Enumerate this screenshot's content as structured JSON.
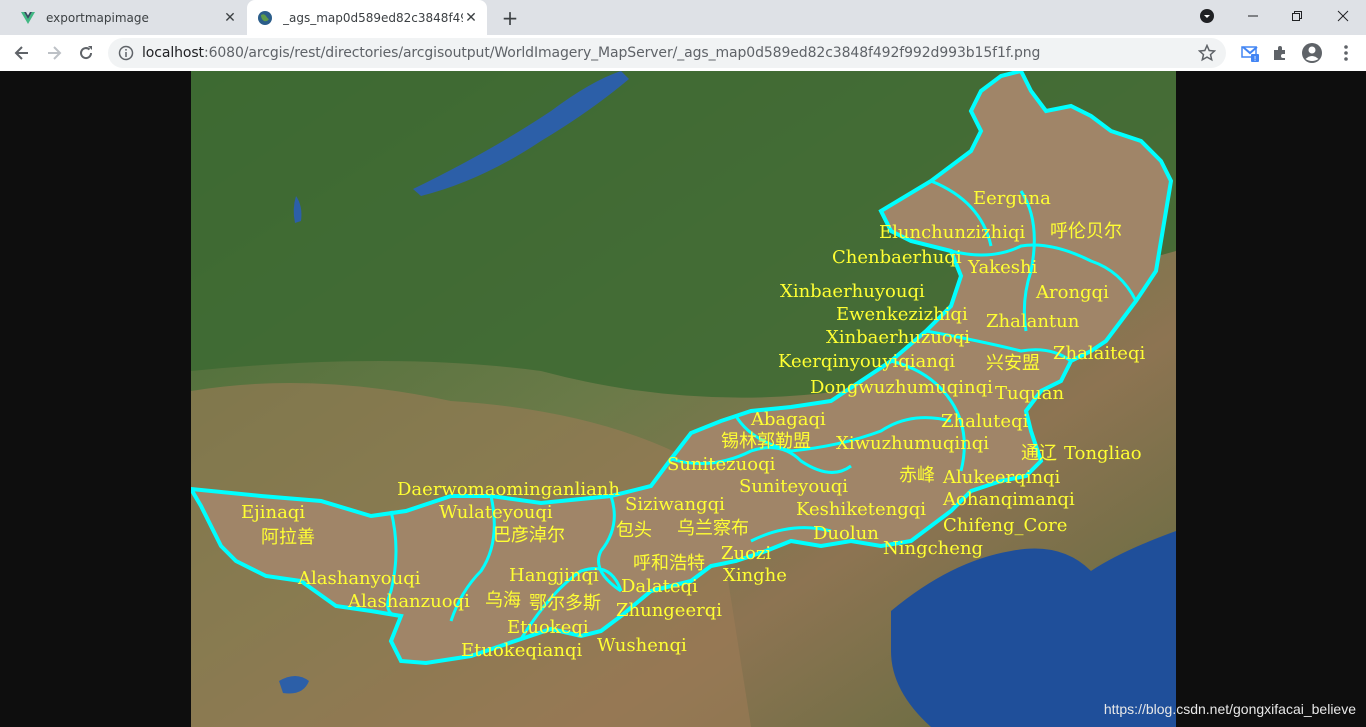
{
  "browser": {
    "tabs": [
      {
        "title": "exportmapimage",
        "active": false
      },
      {
        "title": "_ags_map0d589ed82c3848f49",
        "active": true
      }
    ],
    "new_tab_label": "+",
    "address": {
      "host": "localhost",
      "rest": ":6080/arcgis/rest/directories/arcgisoutput/WorldImagery_MapServer/_ags_map0d589ed82c3848f492f992d993b15f1f.png"
    },
    "icons": {
      "back": "back-arrow-icon",
      "forward": "forward-arrow-icon",
      "reload": "reload-icon",
      "info": "info-icon",
      "star": "bookmark-star-icon",
      "extensions": "puzzle-icon",
      "profile": "profile-icon"
    }
  },
  "map": {
    "accent_outline": "#00ffff",
    "fill": "#a08568",
    "label_color": "#ffff33",
    "labels": [
      "Eerguna",
      "Elunchunzizhiqi",
      "呼伦贝尔",
      "Chenbaerhuqi",
      "Yakeshi",
      "Xinbaerhuyouqi",
      "Arongqi",
      "Ewenkezizhiqi",
      "Zhalantun",
      "Xinbaerhuzuoqi",
      "Keerqinyouyiqianqi",
      "兴安盟",
      "Zhalaiteqi",
      "Dongwuzhumuqinqi",
      "Tuquan",
      "Abagaqi",
      "锡林郭勒盟",
      "Xiwuzhumuqinqi",
      "Zhaluteqi",
      "通辽",
      "Tongliao",
      "Sunitezuoqi",
      "赤峰",
      "Alukeerqinqi",
      "Suniteyouqi",
      "Aohanqimanqi",
      "Daerwomaominganlianh",
      "Siziwangqi",
      "Wulateyouqi",
      "Keshiketengqi",
      "Chifeng_Core",
      "Ejinaqi",
      "巴彦淖尔",
      "包头",
      "乌兰察布",
      "阿拉善",
      "Duolun",
      "Ningcheng",
      "Zuozi",
      "呼和浩特",
      "Xinghe",
      "Hangjinqi",
      "Alashanyouqi",
      "Dalateqi",
      "Alashanzuoqi",
      "乌海",
      "鄂尔多斯",
      "Zhungeerqi",
      "Etuokeqi",
      "Wushenqi",
      "Etuokeqianqi"
    ]
  },
  "watermark": "https://blog.csdn.net/gongxifacai_believe"
}
